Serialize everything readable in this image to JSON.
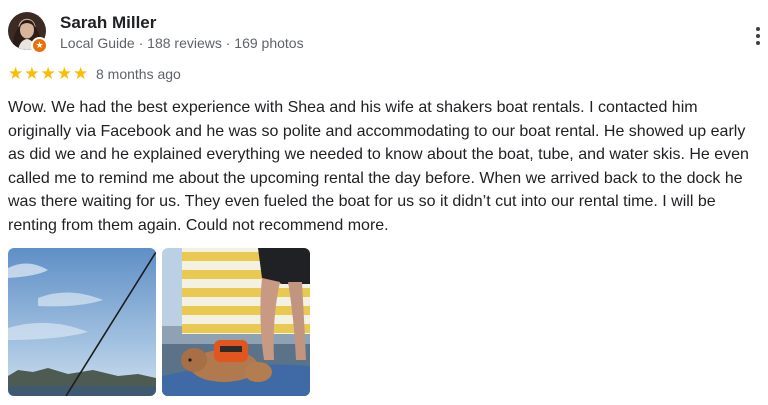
{
  "reviewer": {
    "name": "Sarah Miller",
    "meta": "Local Guide · 188 reviews · 169 photos",
    "avatar_icon": "avatar-portrait",
    "badge_icon": "local-guide-star-icon",
    "badge_color": "#e8710a"
  },
  "menu": {
    "icon": "more-vertical-icon"
  },
  "rating": {
    "stars": 5,
    "max": 5,
    "color": "#fbbc04",
    "date": "8 months ago"
  },
  "review": {
    "text": "Wow. We had the best experience with Shea and his wife at shakers boat rentals. I contacted him originally via Facebook and he was so polite and accommodating to our boat rental. He showed up early as did we and he explained everything we needed to know about the boat, tube, and water skis. He even called me to remind me about the upcoming rental the day before. When we arrived back to the dock he was there waiting for us. They even fueled the boat for us so it didn’t cut into our rental time. I will be renting from them again. Could not recommend more."
  },
  "photos": [
    {
      "subject": "lake-sky-photo"
    },
    {
      "subject": "dog-on-boat-photo"
    }
  ]
}
